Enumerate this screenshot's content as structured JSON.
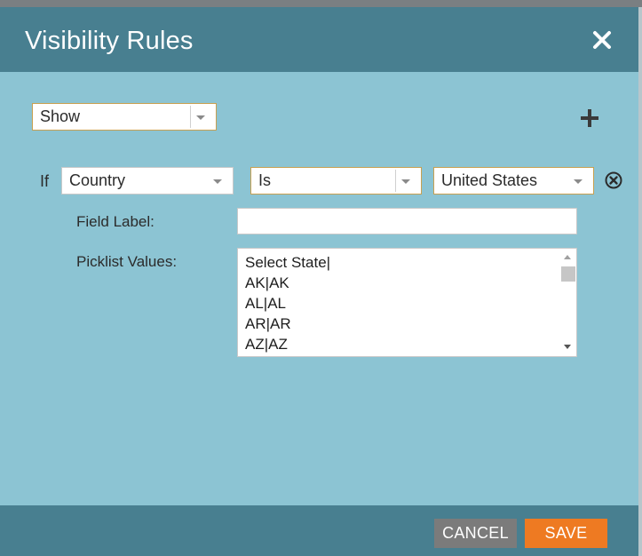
{
  "dialog": {
    "title": "Visibility Rules",
    "close_icon": "close-icon"
  },
  "rule": {
    "action": "Show",
    "add_icon": "plus-icon",
    "condition_prefix": "If",
    "field": "Country",
    "operator": "Is",
    "value": "United States",
    "remove_icon": "remove-circle-icon"
  },
  "form": {
    "field_label_caption": "Field Label:",
    "field_label_value": "",
    "picklist_caption": "Picklist Values:",
    "picklist_values": [
      "Select State|",
      "AK|AK",
      "AL|AL",
      "AR|AR",
      "AZ|AZ"
    ]
  },
  "footer": {
    "cancel_label": "CANCEL",
    "save_label": "SAVE"
  },
  "colors": {
    "header": "#487f90",
    "body": "#8cc4d3",
    "save": "#ee7a22",
    "cancel": "#7b7b7b"
  }
}
